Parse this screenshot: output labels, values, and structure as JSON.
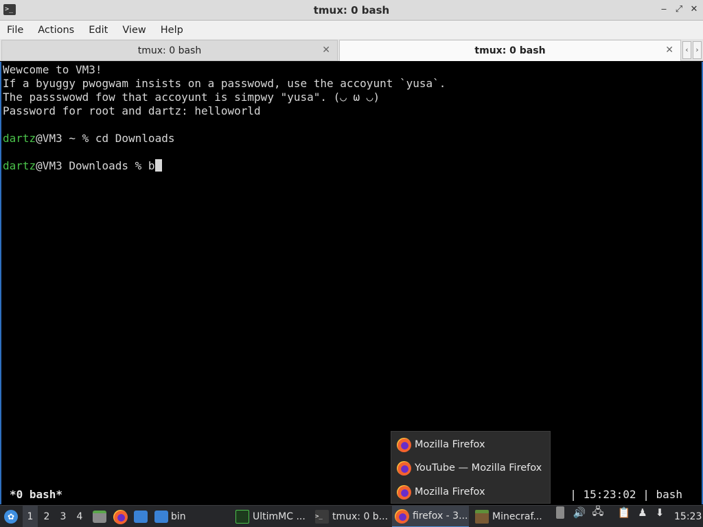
{
  "window": {
    "title": "tmux: 0 bash",
    "app_icon": "terminal-icon",
    "controls": [
      "minimize-icon",
      "maximize-icon",
      "close-icon"
    ]
  },
  "menubar": {
    "items": [
      "File",
      "Actions",
      "Edit",
      "View",
      "Help"
    ]
  },
  "tabs": [
    {
      "label": "tmux: 0 bash",
      "active": false
    },
    {
      "label": "tmux: 0 bash",
      "active": true
    }
  ],
  "tab_scroll": {
    "left": "‹",
    "right": "›"
  },
  "terminal": {
    "motd": [
      "Wewcome to VM3!",
      "If a byuggy pwogwam insists on a passwowd, use the accoyunt `yusa`.",
      "The passswowd fow that accoyunt is simpwy \"yusa\". (◡ ω ◡)",
      "Password for root and dartz: helloworld"
    ],
    "prompt1": {
      "user": "dartz",
      "rest": "@VM3 ~ % cd Downloads"
    },
    "prompt2": {
      "user": "dartz",
      "rest": "@VM3 Downloads % b"
    }
  },
  "tmux_status": {
    "left": "*0 bash*",
    "right": "| 15:23:02 | bash"
  },
  "popup": {
    "items": [
      "Mozilla Firefox",
      "YouTube — Mozilla Firefox",
      "Mozilla Firefox"
    ]
  },
  "taskbar": {
    "desktops": [
      "1",
      "2",
      "3",
      "4"
    ],
    "launcher_bin_label": "bin",
    "tasks": [
      {
        "label": "UltimMC ...",
        "icon": "ultimmc-icon"
      },
      {
        "label": "tmux: 0 b...",
        "icon": "terminal-icon"
      },
      {
        "label": "firefox - 3...",
        "icon": "firefox-icon"
      },
      {
        "label": "Minecraf...",
        "icon": "minecraft-icon"
      }
    ],
    "clock": "15:23"
  },
  "colors": {
    "prompt_user": "#4ac24a",
    "terminal_bg": "#000000",
    "taskbar_bg": "#26272a",
    "accent": "#4c8fd6"
  }
}
